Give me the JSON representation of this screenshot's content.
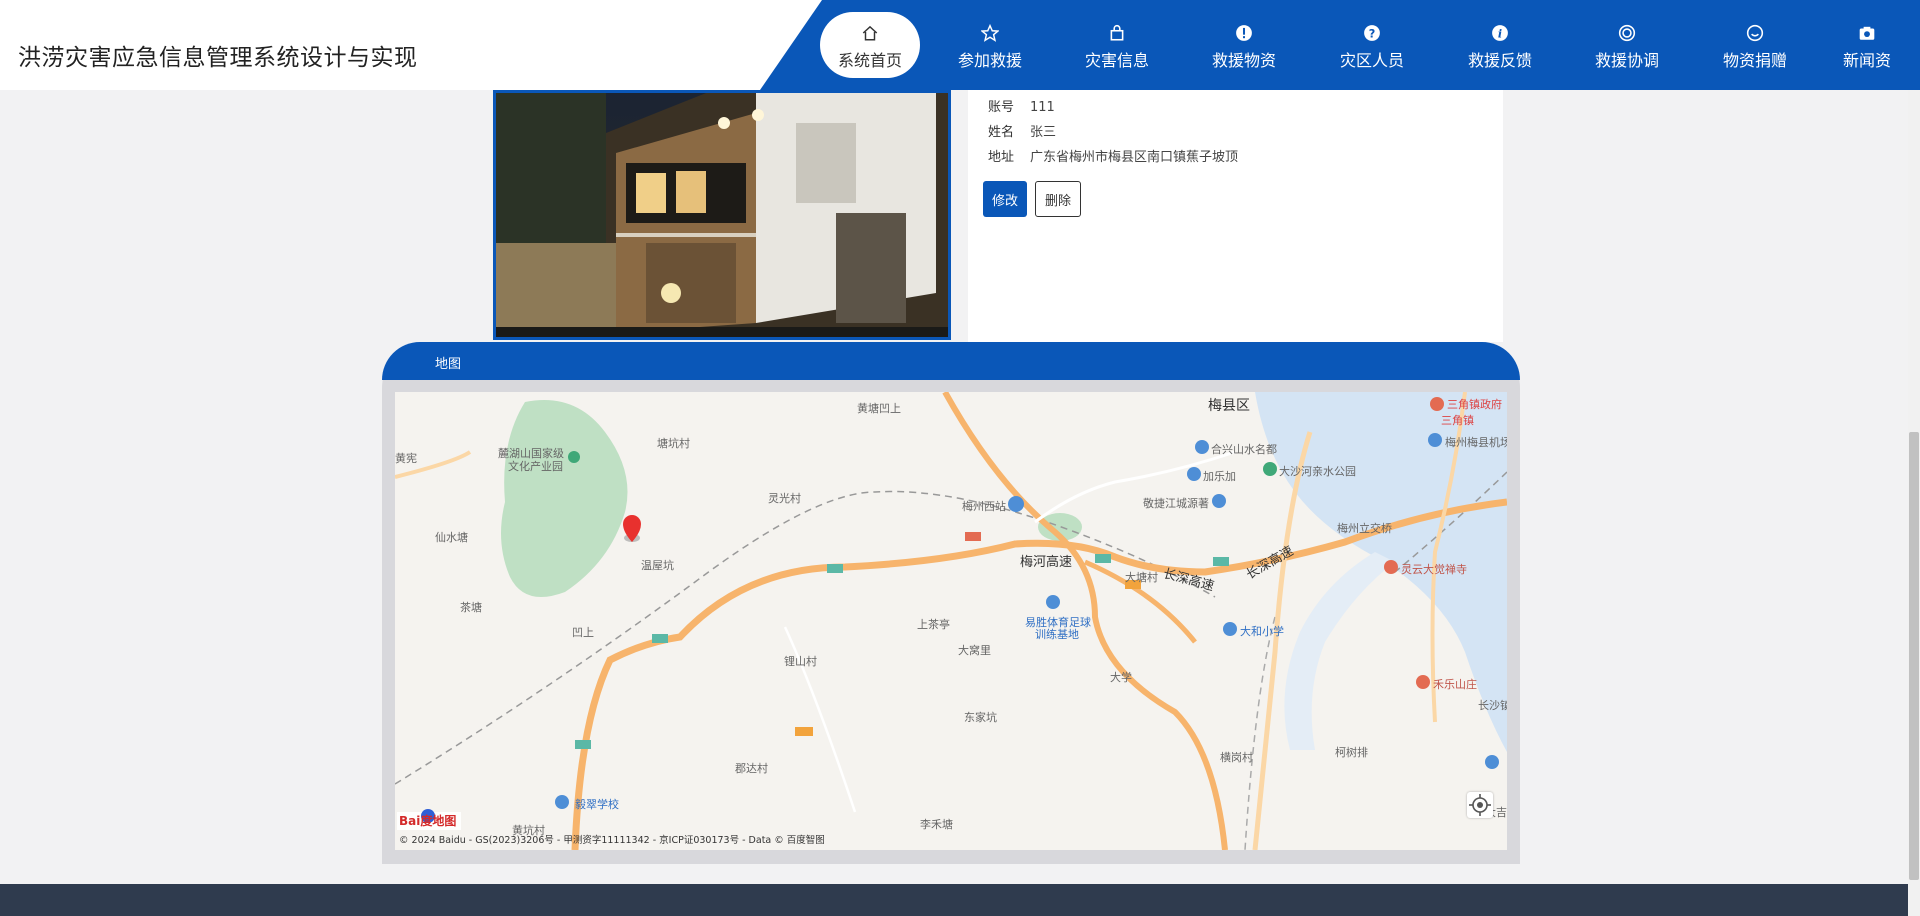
{
  "header": {
    "site_title": "洪涝灾害应急信息管理系统设计与实现",
    "nav": [
      {
        "label": "系统首页",
        "icon": "home-icon",
        "active": true
      },
      {
        "label": "参加救援",
        "icon": "star-icon",
        "active": false
      },
      {
        "label": "灾害信息",
        "icon": "bag-icon",
        "active": false
      },
      {
        "label": "救援物资",
        "icon": "alert-icon",
        "active": false
      },
      {
        "label": "灾区人员",
        "icon": "question-icon",
        "active": false
      },
      {
        "label": "救援反馈",
        "icon": "info-icon",
        "active": false
      },
      {
        "label": "救援协调",
        "icon": "target-icon",
        "active": false
      },
      {
        "label": "物资捐赠",
        "icon": "smile-icon",
        "active": false
      },
      {
        "label": "新闻资",
        "icon": "camera-icon",
        "active": false
      }
    ]
  },
  "record": {
    "fields": [
      {
        "key": "账号",
        "value": "111"
      },
      {
        "key": "姓名",
        "value": "张三"
      },
      {
        "key": "地址",
        "value": "广东省梅州市梅县区南口镇蕉子坡顶"
      }
    ],
    "edit_label": "修改",
    "delete_label": "删除"
  },
  "map_panel": {
    "title": "地图",
    "places": {
      "meixian": "梅县区",
      "sanjiao_gov": "三角镇政府",
      "sanjiao": "三角镇",
      "huangtang": "黄塘凹上",
      "lingguang": "灵光村",
      "luhu": "麓湖山国家级",
      "luhu2": "文化产业园",
      "huangxian": "黄宪",
      "xianshui": "仙水塘",
      "shuxi": "塘坑村",
      "wenwu": "温屋坑",
      "chadeng": "茶塘",
      "aoshang": "凹上",
      "xinglin": "锂山村",
      "shangcha": "上茶亭",
      "dawo": "大窝里",
      "dongjia": "东家坑",
      "junda": "郡达村",
      "lihe": "李禾塘",
      "meizhou_west": "梅州西站",
      "hexing": "合兴山水名都",
      "jiale": "加乐加",
      "jingjiang": "敬捷江城源著",
      "dashahe": "大沙河亲水公园",
      "airport": "梅州梅县机场",
      "lijiaoqiao": "梅州立交桥",
      "meihe": "梅河高速",
      "changshen": "长深高速",
      "changshen2": "长深高速",
      "dalongcun": "大塘村",
      "yisheng": "易胜体育足球",
      "yisheng2": "训练基地",
      "dahe_school": "大和小学",
      "daxue": "大学",
      "hengang": "横岗村",
      "kehu": "柯树排",
      "lingyun": "灵云大觉禅寺",
      "hesanzhuang": "禾乐山庄",
      "changsha": "长沙镇",
      "yicui": "毅翠学校",
      "huangkeng": "黄坑村",
      "dashi": "大吉"
    },
    "copyright": "© 2024 Baidu - GS(2023)3206号 - 甲测资字11111342 - 京ICP证030173号 - Data © 百度智图",
    "logo_text": "Bai度地图"
  }
}
